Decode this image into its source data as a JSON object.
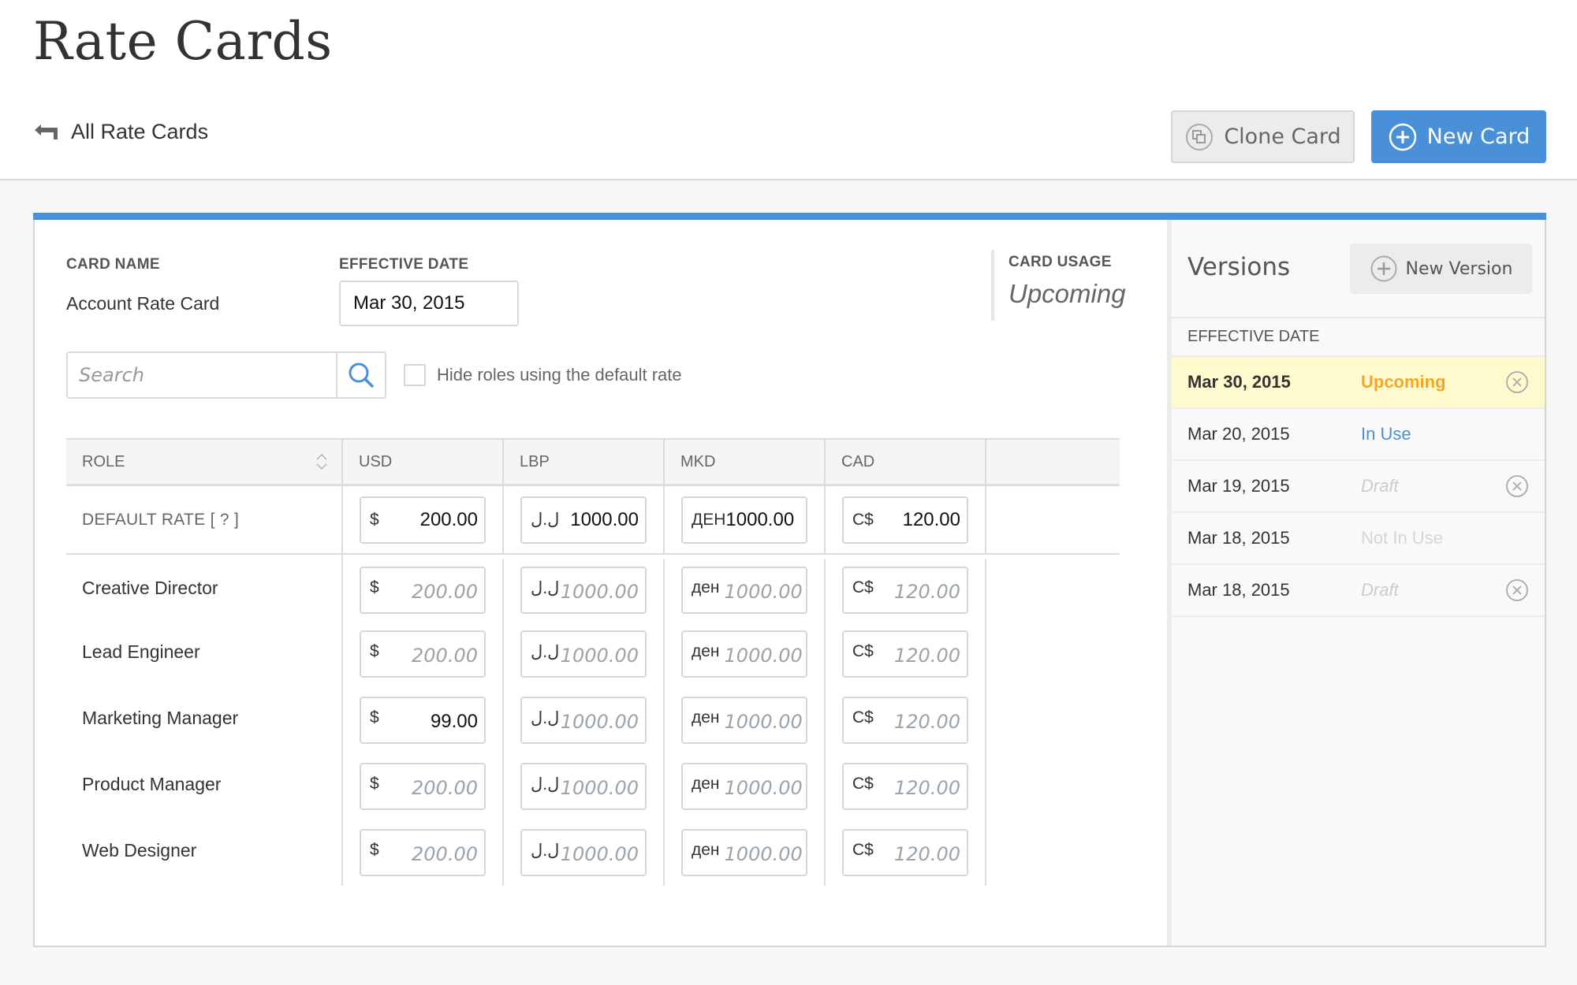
{
  "header": {
    "title": "Rate Cards",
    "back_link": "All Rate Cards",
    "clone_button": "Clone Card",
    "new_button": "New Card"
  },
  "card": {
    "name_label": "CARD NAME",
    "name_value": "Account Rate Card",
    "date_label": "EFFECTIVE DATE",
    "date_value": "Mar 30, 2015",
    "usage_label": "CARD USAGE",
    "usage_value": "Upcoming"
  },
  "filters": {
    "search_placeholder": "Search",
    "search_value": "",
    "hide_default_label": "Hide roles using the default rate",
    "hide_default_checked": false
  },
  "table": {
    "columns": [
      "ROLE",
      "USD",
      "LBP",
      "MKD",
      "CAD"
    ],
    "default_row": {
      "label": "DEFAULT RATE  [ ? ]",
      "rates": [
        {
          "symbol": "$",
          "value": "200.00"
        },
        {
          "symbol": "ل.ل",
          "value": "1000.00"
        },
        {
          "symbol": "ДЕН",
          "value": "1000.00"
        },
        {
          "symbol": "C$",
          "value": "120.00"
        }
      ]
    },
    "rows": [
      {
        "role": "Creative Director",
        "rates": [
          {
            "symbol": "$",
            "value": "200.00",
            "inherited": true
          },
          {
            "symbol": "ل.ل",
            "value": "1000.00",
            "inherited": true
          },
          {
            "symbol": "ден",
            "value": "1000.00",
            "inherited": true
          },
          {
            "symbol": "C$",
            "value": "120.00",
            "inherited": true
          }
        ]
      },
      {
        "role": "Lead Engineer",
        "rates": [
          {
            "symbol": "$",
            "value": "200.00",
            "inherited": true
          },
          {
            "symbol": "ل.ل",
            "value": "1000.00",
            "inherited": true
          },
          {
            "symbol": "ден",
            "value": "1000.00",
            "inherited": true
          },
          {
            "symbol": "C$",
            "value": "120.00",
            "inherited": true
          }
        ]
      },
      {
        "role": "Marketing Manager",
        "rates": [
          {
            "symbol": "$",
            "value": "99.00",
            "inherited": false
          },
          {
            "symbol": "ل.ل",
            "value": "1000.00",
            "inherited": true
          },
          {
            "symbol": "ден",
            "value": "1000.00",
            "inherited": true
          },
          {
            "symbol": "C$",
            "value": "120.00",
            "inherited": true
          }
        ]
      },
      {
        "role": "Product Manager",
        "rates": [
          {
            "symbol": "$",
            "value": "200.00",
            "inherited": true
          },
          {
            "symbol": "ل.ل",
            "value": "1000.00",
            "inherited": true
          },
          {
            "symbol": "ден",
            "value": "1000.00",
            "inherited": true
          },
          {
            "symbol": "C$",
            "value": "120.00",
            "inherited": true
          }
        ]
      },
      {
        "role": "Web Designer",
        "rates": [
          {
            "symbol": "$",
            "value": "200.00",
            "inherited": true
          },
          {
            "symbol": "ل.ل",
            "value": "1000.00",
            "inherited": true
          },
          {
            "symbol": "ден",
            "value": "1000.00",
            "inherited": true
          },
          {
            "symbol": "C$",
            "value": "120.00",
            "inherited": true
          }
        ]
      }
    ]
  },
  "versions": {
    "title": "Versions",
    "new_button": "New Version",
    "column_header": "EFFECTIVE DATE",
    "items": [
      {
        "date": "Mar 30, 2015",
        "status": "Upcoming",
        "status_kind": "upcoming",
        "active": true,
        "removable": true
      },
      {
        "date": "Mar 20, 2015",
        "status": "In Use",
        "status_kind": "inuse",
        "active": false,
        "removable": false
      },
      {
        "date": "Mar 19, 2015",
        "status": "Draft",
        "status_kind": "draft",
        "active": false,
        "removable": true
      },
      {
        "date": "Mar 18, 2015",
        "status": "Not In Use",
        "status_kind": "notinuse",
        "active": false,
        "removable": false
      },
      {
        "date": "Mar 18, 2015",
        "status": "Draft",
        "status_kind": "draft",
        "active": false,
        "removable": true
      }
    ]
  },
  "colors": {
    "accent": "#4a90d9",
    "upcoming": "#f5a623",
    "active_row": "#fffacd",
    "inherited_value": "#9aa4aa"
  }
}
